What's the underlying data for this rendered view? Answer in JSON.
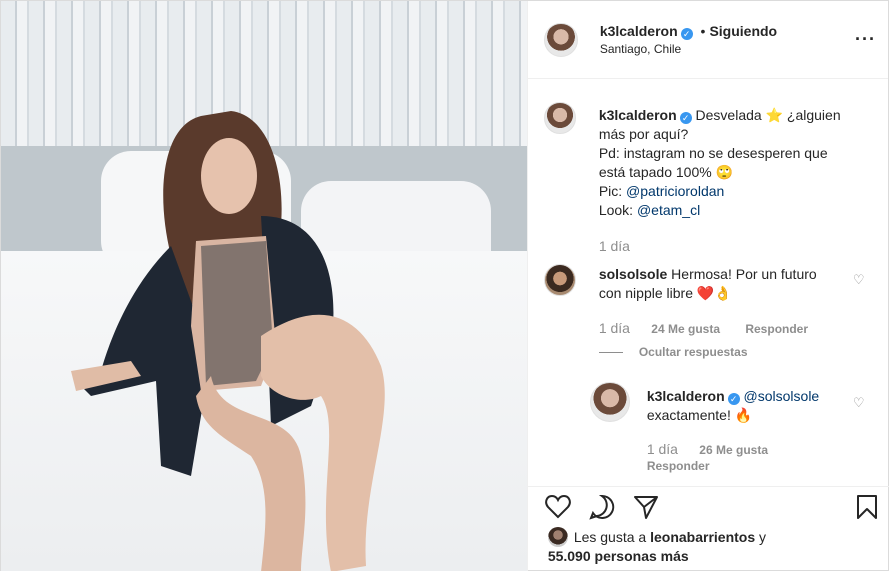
{
  "header": {
    "username": "k3lcalderon",
    "separator": "•",
    "follow_status": "Siguiendo",
    "location": "Santiago, Chile",
    "more_icon": "ellipsis-icon"
  },
  "caption": {
    "username": "k3lcalderon",
    "line1a": "Desvelada",
    "emoji_star": "⭐",
    "line1b": "¿alguien",
    "line2": "más por aquí?",
    "line3": "Pd: instagram no se desesperen que",
    "line4": "está tapado 100%",
    "emoji_face": "🙄",
    "pic_label": "Pic:",
    "pic_link": "@patricioroldan",
    "look_label": "Look:",
    "look_link": "@etam_cl",
    "time": "1 día"
  },
  "comment1": {
    "username": "solsolsole",
    "text1": "Hermosa! Por un futuro",
    "text2": "con nipple libre",
    "emoji": "❤️👌",
    "time": "1 día",
    "likes": "24 Me gusta",
    "reply": "Responder",
    "hide_replies": "Ocultar respuestas"
  },
  "reply1": {
    "username": "k3lcalderon",
    "mention": "@solsolsole",
    "text": "exactamente!",
    "emoji": "🔥",
    "time": "1 día",
    "likes": "26 Me gusta",
    "reply": "Responder"
  },
  "likes": {
    "prefix": "Les gusta a",
    "user": "leonabarrientos",
    "conj": "y",
    "count": "55.090 personas más"
  },
  "colors": {
    "verified": "#3897f0",
    "link": "#00376b",
    "muted": "#8e8e8e",
    "text": "#262626"
  }
}
